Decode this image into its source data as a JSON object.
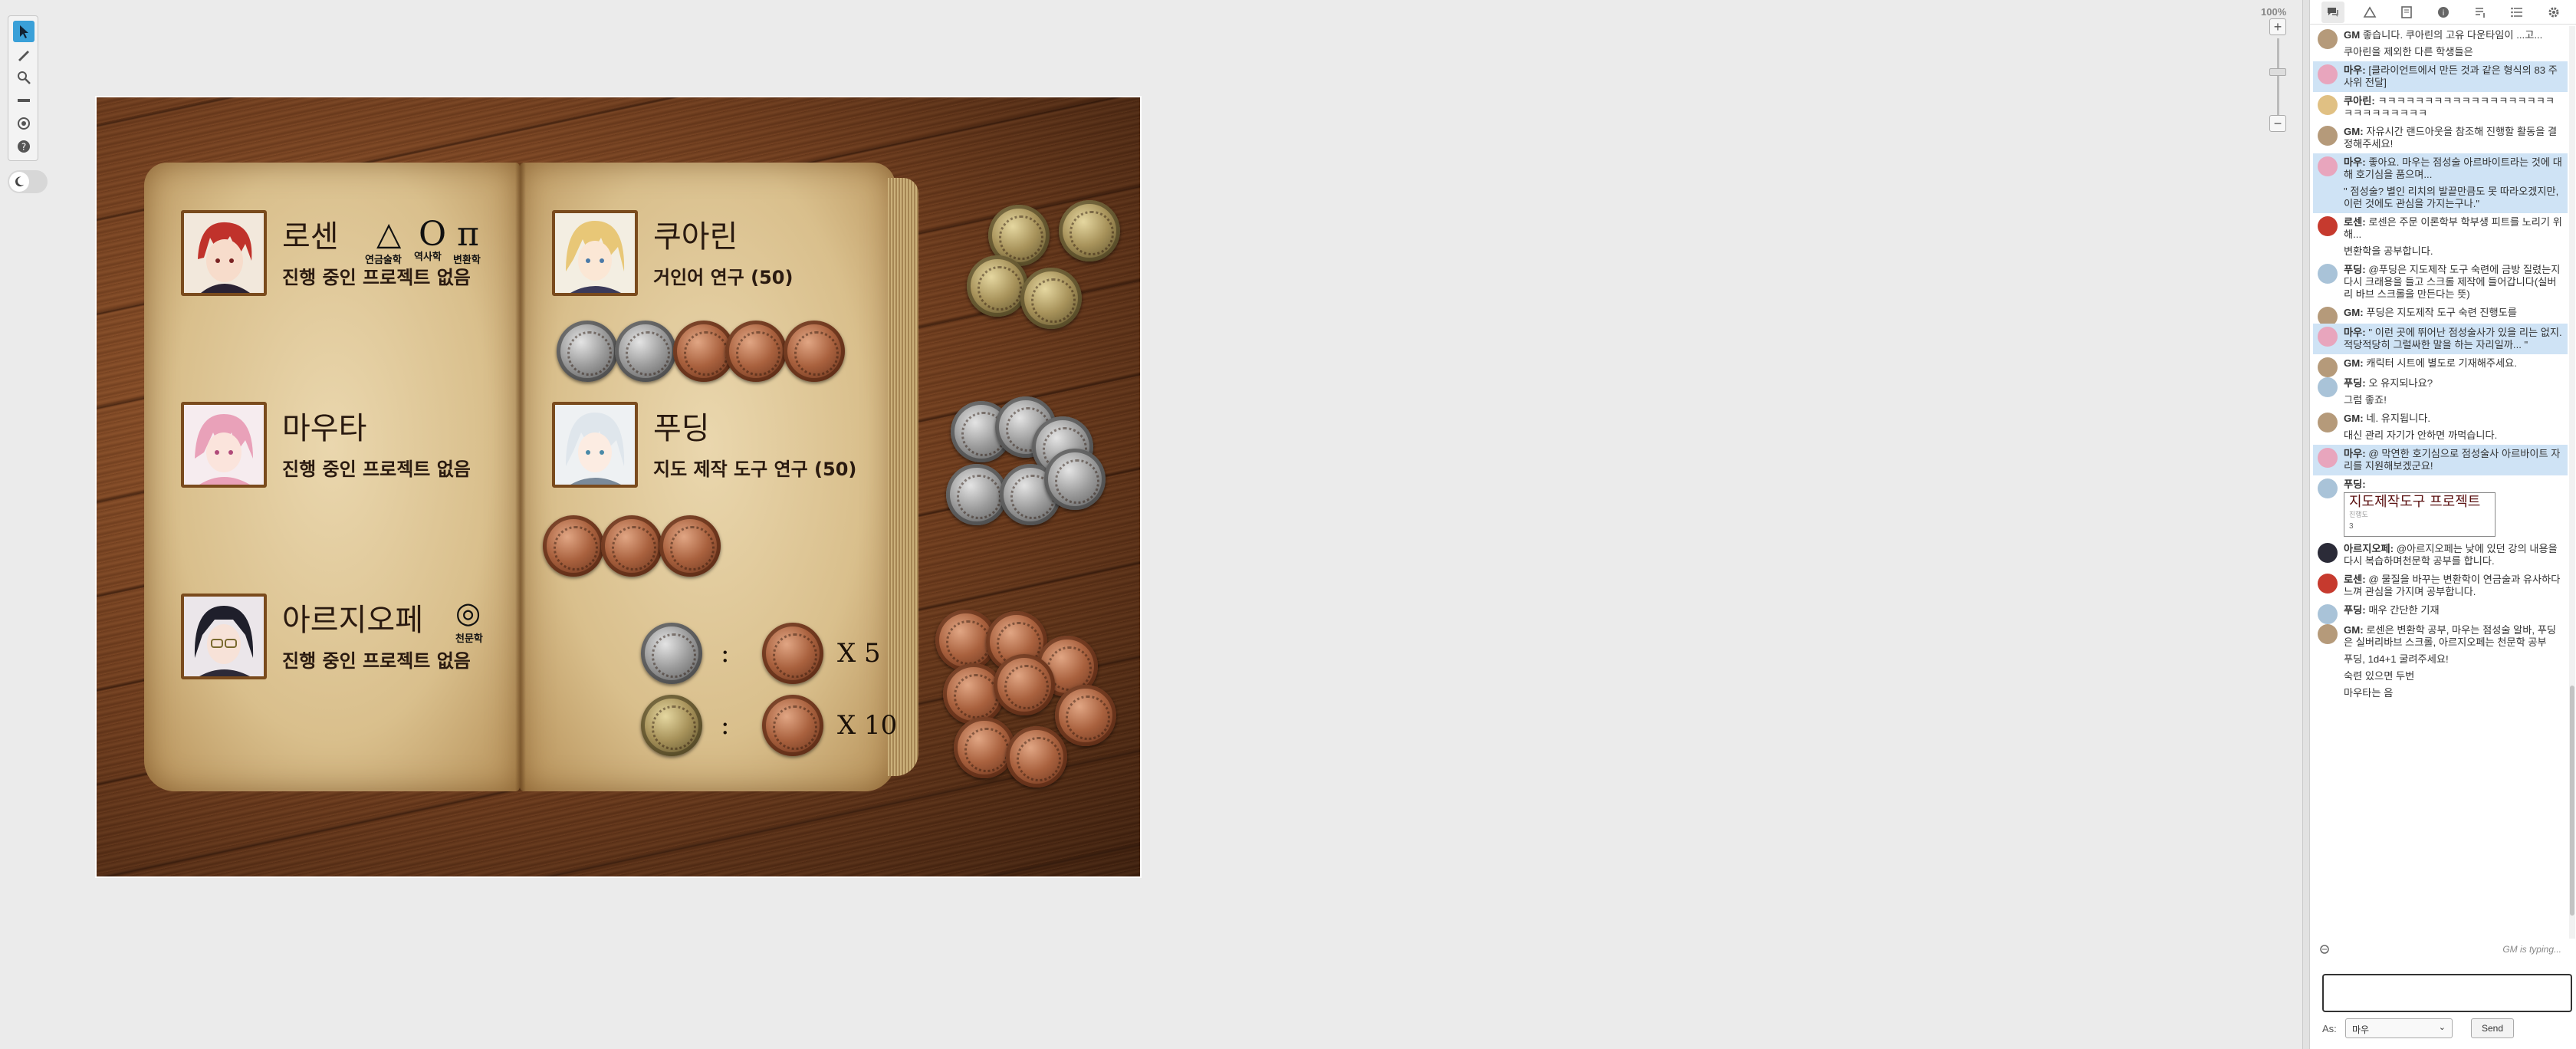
{
  "zoom_level": "100%",
  "toolbar": {
    "tools": [
      "select-tool",
      "draw-tool",
      "zoom-tool",
      "measure-tool",
      "fog-tool",
      "help-tool"
    ],
    "active": "select-tool"
  },
  "book": {
    "left": [
      {
        "name": "로센",
        "status": "진행 중인 프로젝트 없음",
        "skills": [
          {
            "glyph": "🜁",
            "caption": "연금술학"
          },
          {
            "glyph": "O",
            "caption": "역사학"
          },
          {
            "glyph": "ℿ",
            "caption": "변환학"
          }
        ]
      },
      {
        "name": "마우타",
        "status": "진행 중인 프로젝트 없음",
        "skills": []
      },
      {
        "name": "아르지오페",
        "status": "진행 중인 프로젝트 없음",
        "skills": [
          {
            "glyph": "◎",
            "caption": "천문학"
          }
        ]
      }
    ],
    "right": [
      {
        "name": "쿠아린",
        "status": "거인어 연구 (50)"
      },
      {
        "name": "푸딩",
        "status": "지도 제작 도구 연구 (50)"
      }
    ],
    "exchange": [
      {
        "from": "silver",
        "sep": ":",
        "to": "copper",
        "mult": "X 5"
      },
      {
        "from": "gold",
        "sep": ":",
        "to": "copper",
        "mult": "X 10"
      }
    ]
  },
  "sidebar": {
    "tabs": [
      "chat-tab",
      "art-library-tab",
      "journal-tab",
      "compendium-tab",
      "jukebox-tab",
      "collections-tab",
      "settings-tab"
    ],
    "messages": [
      {
        "who": "GM",
        "text": "좋습니다. 쿠아린의 고유 다운타임이 ...고...",
        "cont": [
          "쿠아린을 제외한 다른 학생들은"
        ],
        "hl": false,
        "av": "gm"
      },
      {
        "who": "마우:",
        "text": "[클라이언트에서 만든 것과 같은 형식의 83 주사위 전달]",
        "cont": [],
        "hl": true,
        "av": "mau"
      },
      {
        "who": "쿠아린:",
        "text": "ㅋㅋㅋㅋㅋㅋㅋㅋㅋㅋㅋㅋㅋㅋㅋㅋㅋㅋㅋㅋㅋㅋㅋㅋㅋㅋㅋㅋ",
        "cont": [],
        "hl": false,
        "av": "kua"
      },
      {
        "who": "GM:",
        "text": "자유시간 랜드아웃을 참조해 진행할 활동을 결정해주세요!",
        "cont": [],
        "hl": false,
        "av": "gm"
      },
      {
        "who": "마우:",
        "text": "좋아요. 마우는 점성술 아르바이트라는 것에 대해 호기심을 품으며...",
        "cont": [
          "\" 점성술? 별인 리치의 발끝만큼도 못 따라오겠지만, 이런 것에도 관심을 가지는구나.\""
        ],
        "hl": true,
        "av": "mau"
      },
      {
        "who": "로센:",
        "text": "로센은 주문 이론학부 학부생 피트를 노리기 위해...",
        "cont": [
          "변환학을 공부합니다."
        ],
        "hl": false,
        "av": "rosen"
      },
      {
        "who": "푸딩:",
        "text": "@푸딩은 지도제작 도구 숙련에 금방 질렸는지 다시 크래용을 들고 스크롤 제작에 들어갑니다(실버리 바브 스크롤을 만든다는 뜻)",
        "cont": [],
        "hl": false,
        "av": "pud"
      },
      {
        "who": "GM:",
        "text": "푸딩은 지도제작 도구 숙련 진행도를",
        "cont": [],
        "hl": false,
        "av": "gm"
      },
      {
        "who": "마우:",
        "text": "\" 이런 곳에 뛰어난 점성술사가 있을 리는 없지. 적당적당히 그럴싸한 말을 하는 자리일까... \"",
        "cont": [],
        "hl": true,
        "av": "mau"
      },
      {
        "who": "GM:",
        "text": "캐릭터 시트에 별도로 기재해주세요.",
        "cont": [],
        "hl": false,
        "av": "gm"
      },
      {
        "who": "푸딩:",
        "text": "오 유지되나요?",
        "cont": [
          "그럼 좋죠!"
        ],
        "hl": false,
        "av": "pud"
      },
      {
        "who": "GM:",
        "text": "네. 유지됩니다.",
        "cont": [
          "대신 관리 자기가 안하면 까먹습니다."
        ],
        "hl": false,
        "av": "gm"
      },
      {
        "who": "마우:",
        "text": "@ 막연한 호기심으로 점성술사 아르바이트 자리를 지원해보겠군요!",
        "cont": [],
        "hl": true,
        "av": "mau"
      }
    ],
    "card": {
      "who": "푸딩:",
      "title": "지도제작도구 프로젝트",
      "sub": "진행도",
      "value": "3"
    },
    "messages2": [
      {
        "who": "아르지오페:",
        "text": "@아르지오페는 낮에 있던 강의 내용을 다시 복습하며천문학 공부를 합니다.",
        "cont": [],
        "hl": false,
        "av": "arz"
      },
      {
        "who": "로센:",
        "text": "@ 물질을 바꾸는 변환학이 연금술과 유사하다 느껴 관심을 가지며 공부합니다.",
        "cont": [],
        "hl": false,
        "av": "rosen"
      },
      {
        "who": "푸딩:",
        "text": "매우 간단한 기재",
        "cont": [],
        "hl": false,
        "av": "pud"
      },
      {
        "who": "GM:",
        "text": "로센은 변환학 공부, 마우는 점성술 알바, 푸딩은 실버리바브 스크롤, 아르지오페는 천문학 공부",
        "cont": [
          "푸딩, 1d4+1 굴려주세요!",
          "숙련 있으면 두번",
          "마우타는 음"
        ],
        "hl": false,
        "av": "gm"
      }
    ],
    "typing": "GM is typing...",
    "as_label": "As:",
    "as_value": "마우",
    "send_label": "Send"
  },
  "colors": {
    "accent": "#3aa0d8",
    "highlight": "#cfe3f5"
  }
}
